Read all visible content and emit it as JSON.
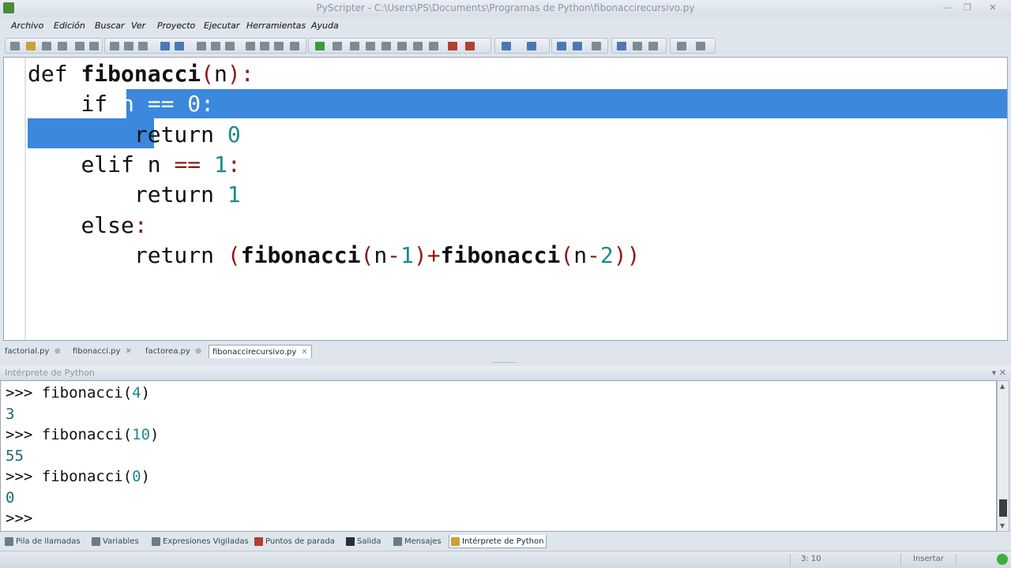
{
  "window": {
    "title": "PyScripter - C:\\Users\\PS\\Documents\\Programas de Python\\fibonaccirecursivo.py",
    "min": "—",
    "max": "❐",
    "close": "✕"
  },
  "menu": [
    "Archivo",
    "Edición",
    "Buscar",
    "Ver",
    "Proyecto",
    "Ejecutar",
    "Herramientas",
    "Ayuda"
  ],
  "editor": {
    "lines": [
      {
        "indent": "",
        "parts": [
          [
            "kw",
            "def "
          ],
          [
            "fn",
            "fibonacci"
          ],
          [
            "paren",
            "("
          ],
          [
            "kw",
            "n"
          ],
          [
            "paren",
            "):"
          ]
        ]
      },
      {
        "indent": "    ",
        "parts": [
          [
            "kw",
            "if "
          ],
          [
            "kw",
            "n "
          ],
          [
            "op",
            "=="
          ],
          [
            "num",
            " 0"
          ],
          [
            "op",
            ":"
          ]
        ]
      },
      {
        "indent": "        ",
        "parts": [
          [
            "kw",
            "return "
          ],
          [
            "num",
            "0"
          ]
        ]
      },
      {
        "indent": "    ",
        "parts": [
          [
            "kw",
            "elif "
          ],
          [
            "kw",
            "n "
          ],
          [
            "op",
            "=="
          ],
          [
            "num",
            " 1"
          ],
          [
            "op",
            ":"
          ]
        ]
      },
      {
        "indent": "        ",
        "parts": [
          [
            "kw",
            "return "
          ],
          [
            "num",
            "1"
          ]
        ]
      },
      {
        "indent": "    ",
        "parts": [
          [
            "kw",
            "else"
          ],
          [
            "op",
            ":"
          ]
        ]
      },
      {
        "indent": "        ",
        "parts": [
          [
            "kw",
            "return "
          ],
          [
            "paren",
            "("
          ],
          [
            "fn",
            "fibonacci"
          ],
          [
            "paren",
            "("
          ],
          [
            "kw",
            "n"
          ],
          [
            "op",
            "-"
          ],
          [
            "num",
            "1"
          ],
          [
            "paren",
            ")"
          ],
          [
            "op",
            "+"
          ],
          [
            "fn",
            "fibonacci"
          ],
          [
            "paren",
            "("
          ],
          [
            "kw",
            "n"
          ],
          [
            "op",
            "-"
          ],
          [
            "num",
            "2"
          ],
          [
            "paren",
            "))"
          ]
        ]
      }
    ]
  },
  "editor_tabs": [
    {
      "label": "factorial.py",
      "close": "⊗"
    },
    {
      "label": "fibonacci.py",
      "close": "✕"
    },
    {
      "label": "factorea.py",
      "close": "⊗"
    },
    {
      "label": "fibonaccirecursivo.py",
      "close": "✕",
      "active": true
    }
  ],
  "interpreter": {
    "title": "Intérprete de Python",
    "controls": "▾ ✕",
    "lines": [
      {
        "prompt": ">>> ",
        "code": "fibonacci(",
        "arg": "4",
        "end": ")"
      },
      {
        "output": "3"
      },
      {
        "prompt": ">>> ",
        "code": "fibonacci(",
        "arg": "10",
        "end": ")"
      },
      {
        "output": "55"
      },
      {
        "prompt": ">>> ",
        "code": "fibonacci(",
        "arg": "0",
        "end": ")"
      },
      {
        "output": "0"
      },
      {
        "prompt": ">>> ",
        "code": "",
        "arg": "",
        "end": ""
      }
    ]
  },
  "bottom_tabs": [
    {
      "label": "Pila de llamadas",
      "icon": "call-stack-icon"
    },
    {
      "label": "Variables",
      "icon": "variables-icon"
    },
    {
      "label": "Expresiones Vigiladas",
      "icon": "watches-icon"
    },
    {
      "label": "Puntos de parada",
      "icon": "breakpoints-icon"
    },
    {
      "label": "Salida",
      "icon": "output-icon"
    },
    {
      "label": "Mensajes",
      "icon": "messages-icon"
    },
    {
      "label": "Intérprete de Python",
      "icon": "python-interpreter-icon",
      "active": true
    }
  ],
  "status": {
    "position": "3: 10",
    "mode": "Insertar"
  }
}
